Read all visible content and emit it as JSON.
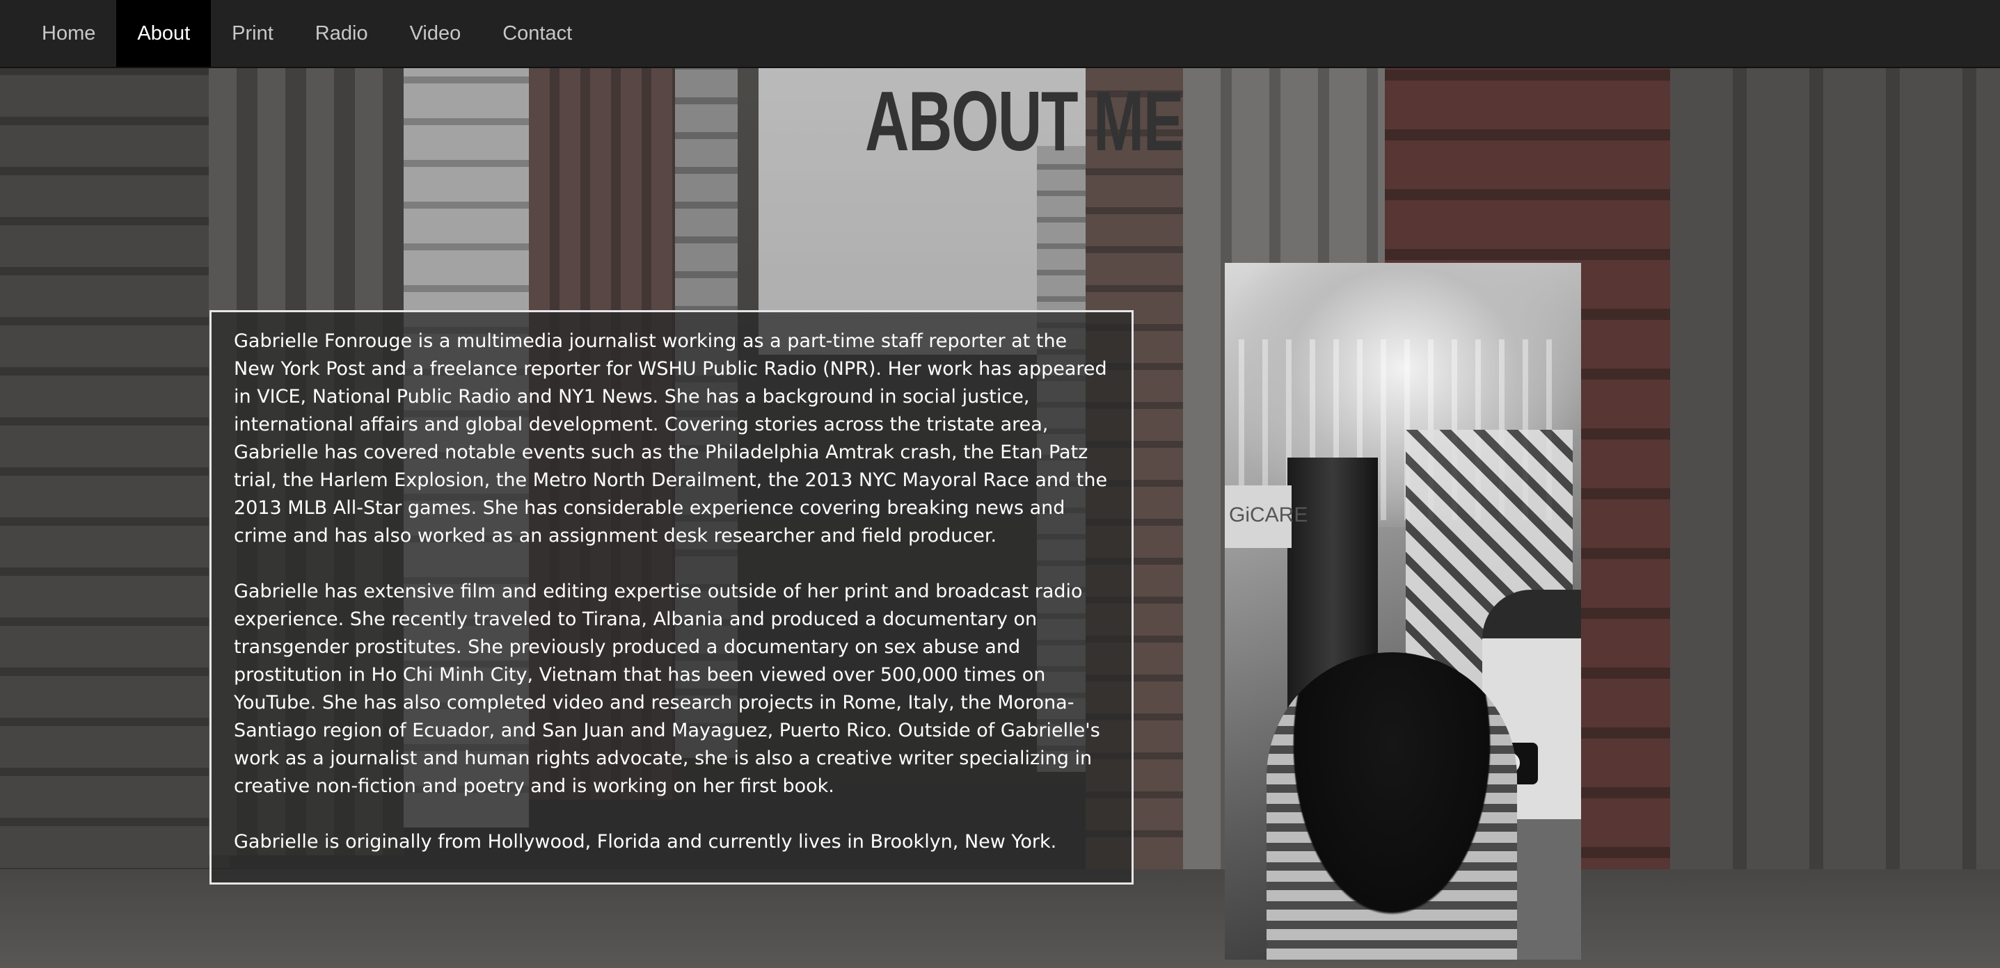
{
  "nav": {
    "items": [
      {
        "label": "Home",
        "active": false
      },
      {
        "label": "About",
        "active": true
      },
      {
        "label": "Print",
        "active": false
      },
      {
        "label": "Radio",
        "active": false
      },
      {
        "label": "Video",
        "active": false
      },
      {
        "label": "Contact",
        "active": false
      }
    ]
  },
  "page": {
    "title": "ABOUT ME"
  },
  "bio": {
    "paragraphs": [
      "Gabrielle Fonrouge is a multimedia journalist working as a part-time staff reporter at the New York Post and a freelance reporter for WSHU Public Radio (NPR). Her work has appeared in VICE, National Public Radio and NY1 News. She has a background in social justice, international affairs and global development. Covering stories across the tristate area, Gabrielle has covered notable events such as the Philadelphia Amtrak crash, the Etan Patz trial, the Harlem Explosion, the Metro North Derailment, the 2013 NYC Mayoral Race and the 2013 MLB All-Star games. She has considerable experience covering breaking news and crime and has also worked as an assignment desk researcher and field producer.",
      "Gabrielle has extensive film and editing expertise outside of her print and broadcast radio experience. She recently traveled to Tirana, Albania and produced a documentary on transgender prostitutes. She previously produced a documentary on sex abuse and prostitution in Ho Chi Minh City, Vietnam that has been viewed over 500,000 times on YouTube. She has also completed video and research projects in Rome, Italy, the Morona-Santiago region of Ecuador, and San Juan and Mayaguez, Puerto Rico. Outside of Gabrielle's work as a journalist and human rights advocate, she is also a creative writer specializing in creative non-fiction and poetry and is working on her first book.",
      "Gabrielle is originally from Hollywood, Florida and currently lives in Brooklyn, New York."
    ]
  },
  "photo": {
    "sign_text": "GiCARE"
  },
  "colors": {
    "nav_bg": "#222222",
    "nav_active_bg": "#000000",
    "title": "#333333",
    "bio_border": "#e6e6e6"
  }
}
